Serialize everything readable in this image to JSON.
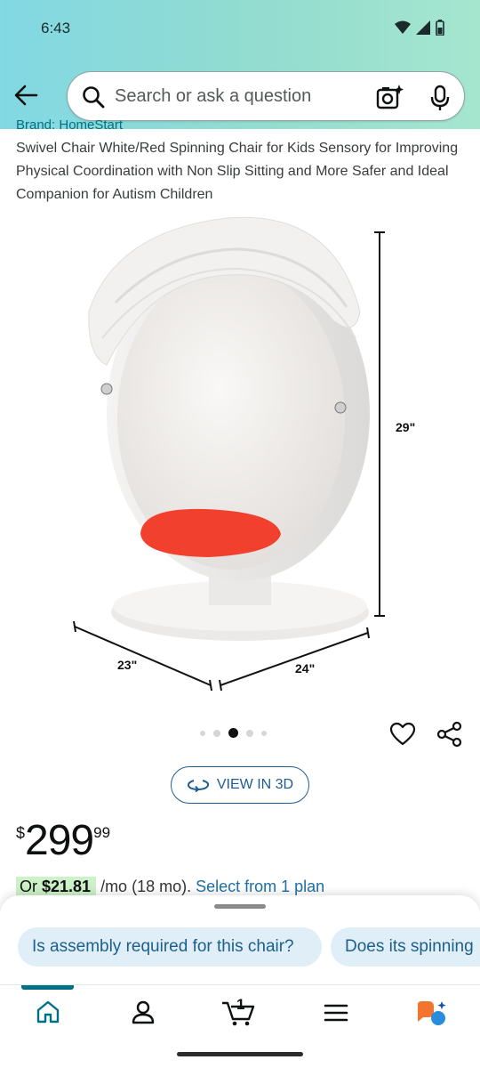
{
  "status_bar": {
    "time": "6:43",
    "icons": [
      "wifi-icon",
      "signal-icon",
      "battery-icon"
    ]
  },
  "header": {
    "back_icon": "arrow-left-icon",
    "search": {
      "placeholder": "Search or ask a question",
      "icons": [
        "search-icon",
        "camera-sparkle-icon",
        "mic-icon"
      ]
    }
  },
  "product": {
    "brand_link": "Brand: HomeStart",
    "title": "Swivel Chair White/Red Spinning Chair for Kids Sensory for Improving Physical Coordination with Non Slip Sitting and More Safer and Ideal Companion for Autism Children",
    "image": {
      "dimensions": {
        "height": "29\"",
        "width_left": "23\"",
        "width_right": "24\""
      }
    },
    "carousel": {
      "count": 5,
      "active_index": 2
    },
    "actions": {
      "wishlist_icon": "heart-icon",
      "share_icon": "share-icon"
    },
    "view_3d_label": "VIEW IN 3D",
    "price": {
      "symbol": "$",
      "whole": "299",
      "fraction": "99"
    },
    "monthly": {
      "prefix": "Or ",
      "amount": "$21.81",
      "suffix": " /mo (18 mo). ",
      "link": "Select from 1 plan"
    }
  },
  "bottom_sheet": {
    "questions": [
      "Is assembly required for this chair?",
      "Does its spinning"
    ]
  },
  "bottom_nav": {
    "items": [
      {
        "name": "home",
        "icon": "home-icon",
        "active": true
      },
      {
        "name": "account",
        "icon": "person-icon"
      },
      {
        "name": "cart",
        "icon": "cart-icon",
        "badge": "1"
      },
      {
        "name": "menu",
        "icon": "menu-icon"
      },
      {
        "name": "rufus",
        "icon": "rufus-icon"
      }
    ]
  },
  "colors": {
    "header_gradient_start": "#82d8e3",
    "header_gradient_end": "#a5e6cf",
    "link": "#007185",
    "cushion": "#f2402f",
    "chip_bg": "#dfeef7",
    "monthly_pill": "#cdf1c8"
  }
}
